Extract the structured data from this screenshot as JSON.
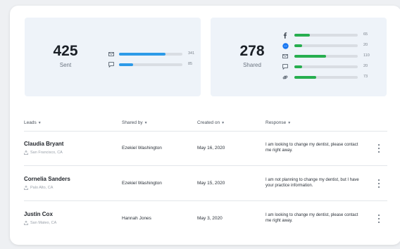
{
  "sent": {
    "value": "425",
    "label": "Sent",
    "metrics": [
      {
        "icon": "mail-icon",
        "value": "341",
        "fraction": 0.73,
        "color": "#2d9ae8"
      },
      {
        "icon": "chat-icon",
        "value": "85",
        "fraction": 0.22,
        "color": "#2d9ae8"
      }
    ]
  },
  "shared": {
    "value": "278",
    "label": "Shared",
    "metrics": [
      {
        "icon": "facebook-icon",
        "value": "65",
        "fraction": 0.24,
        "color": "#27ae4f"
      },
      {
        "icon": "messenger-icon",
        "value": "20",
        "fraction": 0.12,
        "color": "#27ae4f"
      },
      {
        "icon": "mail-icon",
        "value": "110",
        "fraction": 0.5,
        "color": "#27ae4f"
      },
      {
        "icon": "chat-icon",
        "value": "20",
        "fraction": 0.12,
        "color": "#27ae4f"
      },
      {
        "icon": "link-icon",
        "value": "73",
        "fraction": 0.34,
        "color": "#27ae4f"
      }
    ]
  },
  "table": {
    "headers": {
      "leads": "Leads",
      "shared_by": "Shared by",
      "created_on": "Created on",
      "response": "Response"
    },
    "rows": [
      {
        "name": "Claudia Bryant",
        "location": "San Francisco, CA",
        "shared_by": "Ezekiel Washington",
        "created_on": "May 16, 2020",
        "response": "I am looking to change my dentist, please contact me right away."
      },
      {
        "name": "Cornelia Sanders",
        "location": "Palo Alto, CA",
        "shared_by": "Ezekiel Washington",
        "created_on": "May 15, 2020",
        "response": "I am not planning to change my dentist, but I have your practice information."
      },
      {
        "name": "Justin Cox",
        "location": "San Mateo, CA",
        "shared_by": "Hannah Jones",
        "created_on": "May 3, 2020",
        "response": "I am looking to change my dentist, please contact me right away."
      }
    ]
  }
}
